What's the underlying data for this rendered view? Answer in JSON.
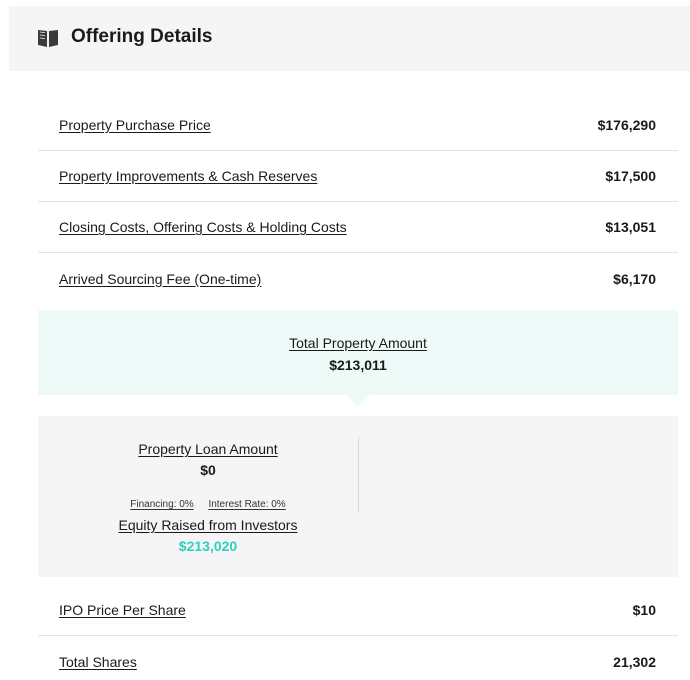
{
  "header": {
    "title": "Offering Details",
    "icon": "book-icon"
  },
  "rows_top": [
    {
      "label": "Property Purchase Price",
      "value": "$176,290"
    },
    {
      "label": "Property Improvements & Cash Reserves",
      "value": "$17,500"
    },
    {
      "label": "Closing Costs, Offering Costs & Holding Costs",
      "value": "$13,051"
    },
    {
      "label": "Arrived Sourcing Fee (One-time)",
      "value": "$6,170"
    }
  ],
  "total": {
    "label": "Total Property Amount",
    "value": "$213,011"
  },
  "loan": {
    "label": "Property Loan Amount",
    "value": "$0",
    "financing": "Financing: 0%",
    "interest_rate": "Interest Rate: 0%"
  },
  "equity": {
    "label": "Equity Raised from Investors",
    "value": "$213,020"
  },
  "rows_bottom": [
    {
      "label": "IPO Price Per Share",
      "value": "$10"
    },
    {
      "label": "Total Shares",
      "value": "21,302"
    }
  ],
  "colors": {
    "accent": "#2ecfbe",
    "total_bg": "#eefaf8",
    "panel_bg": "#f5f5f6"
  }
}
